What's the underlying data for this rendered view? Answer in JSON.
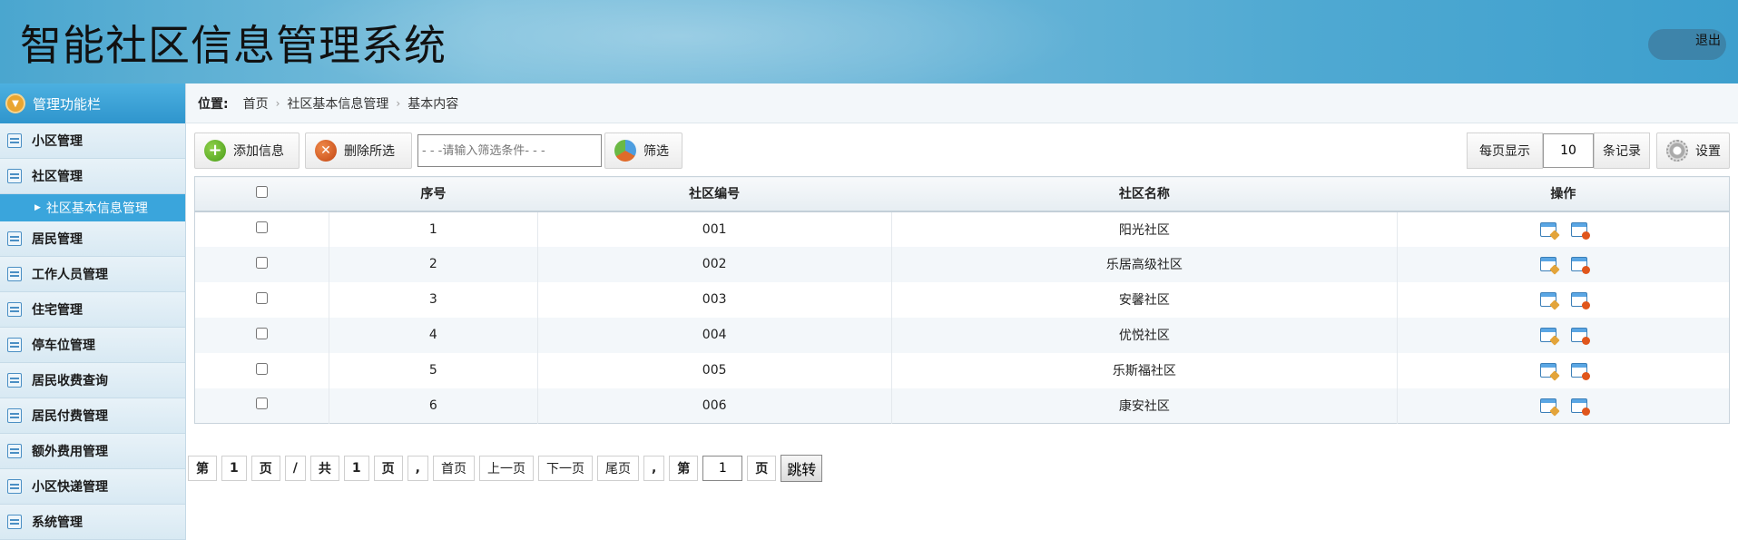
{
  "header": {
    "title": "智能社区信息管理系统",
    "logout_label": "退出"
  },
  "sidebar": {
    "title": "管理功能栏",
    "items": [
      {
        "label": "小区管理",
        "icon": "list-icon"
      },
      {
        "label": "社区管理",
        "icon": "chat-icon"
      },
      {
        "label": "居民管理",
        "icon": "edit-icon"
      },
      {
        "label": "工作人员管理",
        "icon": "calendar-icon"
      },
      {
        "label": "住宅管理",
        "icon": "calendar-icon"
      },
      {
        "label": "停车位管理",
        "icon": "calendar-icon"
      },
      {
        "label": "居民收费查询",
        "icon": "calendar-icon"
      },
      {
        "label": "居民付费管理",
        "icon": "calendar-icon"
      },
      {
        "label": "额外费用管理",
        "icon": "calendar-icon"
      },
      {
        "label": "小区快递管理",
        "icon": "calendar-icon"
      },
      {
        "label": "系统管理",
        "icon": "calendar-icon"
      }
    ],
    "active_sub": "社区基本信息管理"
  },
  "breadcrumb": {
    "label": "位置:",
    "items": [
      "首页",
      "社区基本信息管理",
      "基本内容"
    ]
  },
  "toolbar": {
    "add_label": "添加信息",
    "delete_label": "删除所选",
    "filter_placeholder": "- - -请输入筛选条件- - -",
    "filter_label": "筛选",
    "per_page_label": "每页显示",
    "per_page_value": "10",
    "records_label": "条记录",
    "settings_label": "设置"
  },
  "table": {
    "headers": [
      "",
      "序号",
      "社区编号",
      "社区名称",
      "操作"
    ],
    "rows": [
      {
        "seq": "1",
        "code": "001",
        "name": "阳光社区"
      },
      {
        "seq": "2",
        "code": "002",
        "name": "乐居高级社区"
      },
      {
        "seq": "3",
        "code": "003",
        "name": "安馨社区"
      },
      {
        "seq": "4",
        "code": "004",
        "name": "优悦社区"
      },
      {
        "seq": "5",
        "code": "005",
        "name": "乐斯福社区"
      },
      {
        "seq": "6",
        "code": "006",
        "name": "康安社区"
      }
    ]
  },
  "pager": {
    "di": "第",
    "current_page": "1",
    "ye": "页",
    "slash": "/",
    "gong": "共",
    "total_pages": "1",
    "ye2": "页",
    "comma": ",",
    "first": "首页",
    "prev": "上一页",
    "next": "下一页",
    "last": "尾页",
    "comma2": ",",
    "di2": "第",
    "jump_value": "1",
    "ye3": "页",
    "go_label": "跳转"
  }
}
